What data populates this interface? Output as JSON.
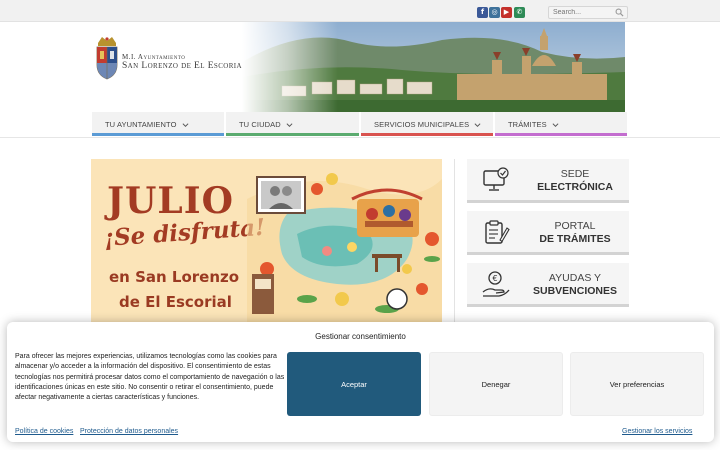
{
  "topbar": {
    "social": [
      {
        "name": "facebook-icon",
        "glyph": "f",
        "color": "#3b5998"
      },
      {
        "name": "instagram-icon",
        "glyph": "◎",
        "color": "#3f729b"
      },
      {
        "name": "youtube-icon",
        "glyph": "▶",
        "color": "#c4302b"
      },
      {
        "name": "phone-icon",
        "glyph": "✆",
        "color": "#2e8b57"
      }
    ],
    "search_placeholder": "Search..."
  },
  "header": {
    "logo_line1": "M.I. Ayuntamiento",
    "logo_line2": "San Lorenzo de El Escorial"
  },
  "nav": {
    "items": [
      {
        "label": "TU AYUNTAMIENTO",
        "color": "#5b9bd5"
      },
      {
        "label": "TU CIUDAD",
        "color": "#5bab6f"
      },
      {
        "label": "SERVICIOS MUNICIPALES",
        "color": "#d9534f"
      },
      {
        "label": "TRÁMITES",
        "color": "#c36dcf"
      }
    ]
  },
  "banner": {
    "line1": "JULIO",
    "line2": "¡Se disfruta!",
    "line3": "en San Lorenzo",
    "line4": "de El Escorial"
  },
  "sidebar": {
    "buttons": [
      {
        "line1": "SEDE",
        "line2": "ELECTRÓNICA",
        "icon": "monitor-check-icon"
      },
      {
        "line1": "PORTAL",
        "line2": "DE TRÁMITES",
        "icon": "clipboard-pen-icon"
      },
      {
        "line1": "AYUDAS Y",
        "line2": "SUBVENCIONES",
        "icon": "euro-hand-icon"
      }
    ]
  },
  "cookie": {
    "title": "Gestionar consentimiento",
    "text": "Para ofrecer las mejores experiencias, utilizamos tecnologías como las cookies para almacenar y/o acceder a la información del dispositivo. El consentimiento de estas tecnologías nos permitirá procesar datos como el comportamiento de navegación o las identificaciones únicas en este sitio. No consentir o retirar el consentimiento, puede afectar negativamente a ciertas características y funciones.",
    "accept": "Aceptar",
    "deny": "Denegar",
    "prefs": "Ver preferencias",
    "link_cookies": "Política de cookies",
    "link_privacy": "Protección de datos personales",
    "link_services": "Gestionar los servicios"
  }
}
